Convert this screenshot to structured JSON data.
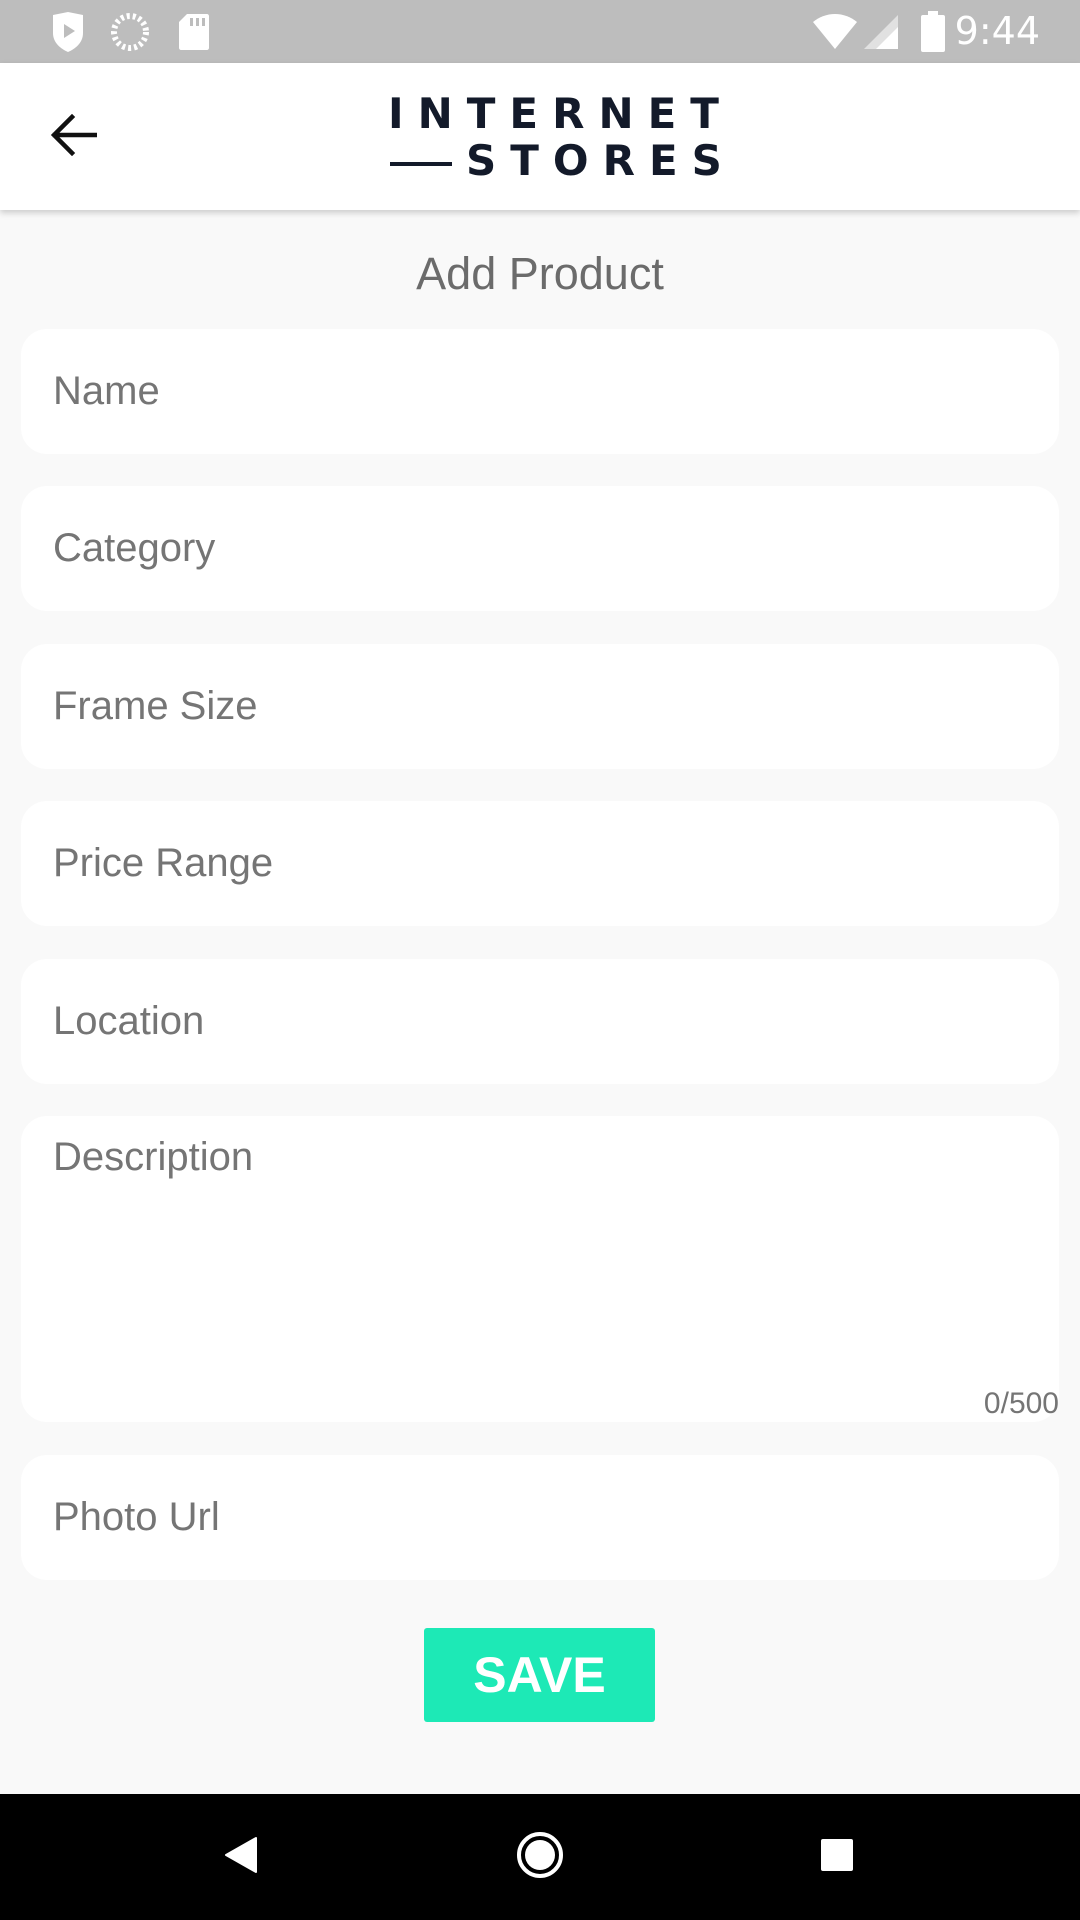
{
  "status_bar": {
    "time": "9:44",
    "left_icons": [
      "play-protect-icon",
      "loading-circle-icon",
      "sd-card-icon"
    ],
    "right_icons": [
      "wifi-icon",
      "cell-signal-icon",
      "battery-icon"
    ]
  },
  "app_bar": {
    "back_icon": "arrow-back-icon",
    "logo_line1": "INTERNET",
    "logo_line2": "STORES"
  },
  "page": {
    "title": "Add Product",
    "fields": {
      "name": {
        "placeholder": "Name",
        "value": ""
      },
      "category": {
        "placeholder": "Category",
        "value": ""
      },
      "frame_size": {
        "placeholder": "Frame Size",
        "value": ""
      },
      "price_range": {
        "placeholder": "Price Range",
        "value": ""
      },
      "location": {
        "placeholder": "Location",
        "value": ""
      },
      "description": {
        "placeholder": "Description",
        "value": "",
        "counter": "0/500"
      },
      "photo_url": {
        "placeholder": "Photo Url",
        "value": ""
      }
    },
    "save_label": "SAVE"
  },
  "nav_bar": {
    "icons": [
      "nav-back-icon",
      "nav-home-icon",
      "nav-recents-icon"
    ]
  },
  "colors": {
    "accent": "#1de9b6",
    "status_bar": "#bdbdbd",
    "background": "#f9f9f9",
    "logo": "#131a2a"
  }
}
